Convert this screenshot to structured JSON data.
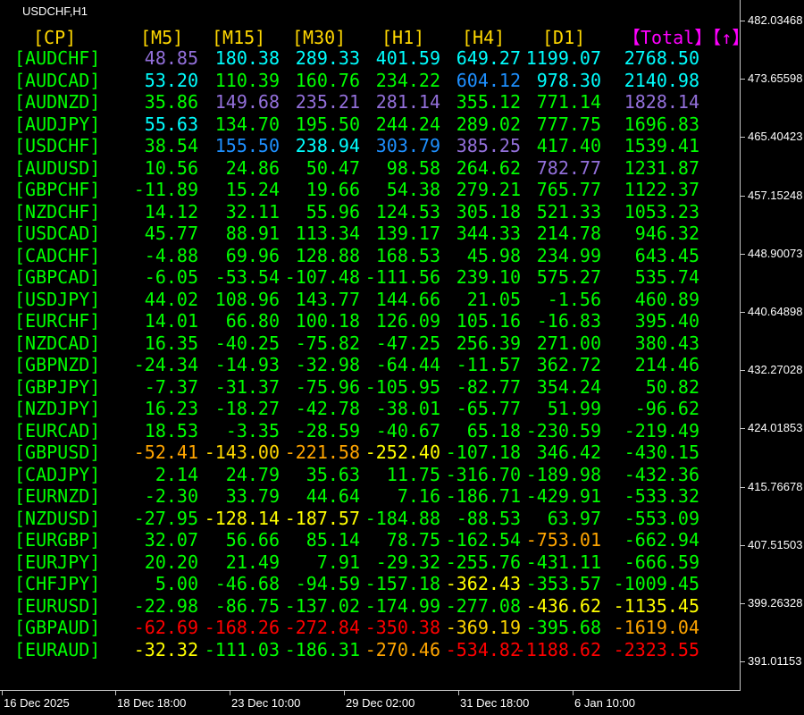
{
  "symbol_label": "USDCHF,H1",
  "headers": [
    "[CP]",
    "[M5]",
    "[M15]",
    "[M30]",
    "[H1]",
    "[H4]",
    "[D1]",
    "【Total】【↑】"
  ],
  "colors": {
    "green": "#00ff00",
    "yellow": "#ffff00",
    "header_yellow": "#ffd700",
    "magenta": "#ff00ff",
    "purple": "#9370db",
    "cyan": "#00ffff",
    "skyblue": "#1e90ff",
    "orange": "#ffa500",
    "gold": "#ffd700",
    "red": "#ff0000"
  },
  "rows": [
    {
      "pair": "[AUDCHF]",
      "values": [
        "48.85",
        "180.38",
        "289.33",
        "401.59",
        "649.27",
        "1199.07",
        "2768.50"
      ],
      "colors": [
        "purple",
        "cyan",
        "cyan",
        "cyan",
        "cyan",
        "cyan",
        "cyan"
      ]
    },
    {
      "pair": "[AUDCAD]",
      "values": [
        "53.20",
        "110.39",
        "160.76",
        "234.22",
        "604.12",
        "978.30",
        "2140.98"
      ],
      "colors": [
        "cyan",
        "green",
        "green",
        "green",
        "skyblue",
        "cyan",
        "cyan"
      ]
    },
    {
      "pair": "[AUDNZD]",
      "values": [
        "35.86",
        "149.68",
        "235.21",
        "281.14",
        "355.12",
        "771.14",
        "1828.14"
      ],
      "colors": [
        "green",
        "purple",
        "purple",
        "purple",
        "green",
        "green",
        "purple"
      ]
    },
    {
      "pair": "[AUDJPY]",
      "values": [
        "55.63",
        "134.70",
        "195.50",
        "244.24",
        "289.02",
        "777.75",
        "1696.83"
      ],
      "colors": [
        "cyan",
        "green",
        "green",
        "green",
        "green",
        "green",
        "green"
      ]
    },
    {
      "pair": "[USDCHF]",
      "values": [
        "38.54",
        "155.50",
        "238.94",
        "303.79",
        "385.25",
        "417.40",
        "1539.41"
      ],
      "colors": [
        "green",
        "skyblue",
        "cyan",
        "skyblue",
        "purple",
        "green",
        "green"
      ]
    },
    {
      "pair": "[AUDUSD]",
      "values": [
        "10.56",
        "24.86",
        "50.47",
        "98.58",
        "264.62",
        "782.77",
        "1231.87"
      ],
      "colors": [
        "green",
        "green",
        "green",
        "green",
        "green",
        "purple",
        "green"
      ]
    },
    {
      "pair": "[GBPCHF]",
      "values": [
        "-11.89",
        "15.24",
        "19.66",
        "54.38",
        "279.21",
        "765.77",
        "1122.37"
      ],
      "colors": [
        "green",
        "green",
        "green",
        "green",
        "green",
        "green",
        "green"
      ]
    },
    {
      "pair": "[NZDCHF]",
      "values": [
        "14.12",
        "32.11",
        "55.96",
        "124.53",
        "305.18",
        "521.33",
        "1053.23"
      ],
      "colors": [
        "green",
        "green",
        "green",
        "green",
        "green",
        "green",
        "green"
      ]
    },
    {
      "pair": "[USDCAD]",
      "values": [
        "45.77",
        "88.91",
        "113.34",
        "139.17",
        "344.33",
        "214.78",
        "946.32"
      ],
      "colors": [
        "green",
        "green",
        "green",
        "green",
        "green",
        "green",
        "green"
      ]
    },
    {
      "pair": "[CADCHF]",
      "values": [
        "-4.88",
        "69.96",
        "128.88",
        "168.53",
        "45.98",
        "234.99",
        "643.45"
      ],
      "colors": [
        "green",
        "green",
        "green",
        "green",
        "green",
        "green",
        "green"
      ]
    },
    {
      "pair": "[GBPCAD]",
      "values": [
        "-6.05",
        "-53.54",
        "-107.48",
        "-111.56",
        "239.10",
        "575.27",
        "535.74"
      ],
      "colors": [
        "green",
        "green",
        "green",
        "green",
        "green",
        "green",
        "green"
      ]
    },
    {
      "pair": "[USDJPY]",
      "values": [
        "44.02",
        "108.96",
        "143.77",
        "144.66",
        "21.05",
        "-1.56",
        "460.89"
      ],
      "colors": [
        "green",
        "green",
        "green",
        "green",
        "green",
        "green",
        "green"
      ]
    },
    {
      "pair": "[EURCHF]",
      "values": [
        "14.01",
        "66.80",
        "100.18",
        "126.09",
        "105.16",
        "-16.83",
        "395.40"
      ],
      "colors": [
        "green",
        "green",
        "green",
        "green",
        "green",
        "green",
        "green"
      ]
    },
    {
      "pair": "[NZDCAD]",
      "values": [
        "16.35",
        "-40.25",
        "-75.82",
        "-47.25",
        "256.39",
        "271.00",
        "380.43"
      ],
      "colors": [
        "green",
        "green",
        "green",
        "green",
        "green",
        "green",
        "green"
      ]
    },
    {
      "pair": "[GBPNZD]",
      "values": [
        "-24.34",
        "-14.93",
        "-32.98",
        "-64.44",
        "-11.57",
        "362.72",
        "214.46"
      ],
      "colors": [
        "green",
        "green",
        "green",
        "green",
        "green",
        "green",
        "green"
      ]
    },
    {
      "pair": "[GBPJPY]",
      "values": [
        "-7.37",
        "-31.37",
        "-75.96",
        "-105.95",
        "-82.77",
        "354.24",
        "50.82"
      ],
      "colors": [
        "green",
        "green",
        "green",
        "green",
        "green",
        "green",
        "green"
      ]
    },
    {
      "pair": "[NZDJPY]",
      "values": [
        "16.23",
        "-18.27",
        "-42.78",
        "-38.01",
        "-65.77",
        "51.99",
        "-96.62"
      ],
      "colors": [
        "green",
        "green",
        "green",
        "green",
        "green",
        "green",
        "green"
      ]
    },
    {
      "pair": "[EURCAD]",
      "values": [
        "18.53",
        "-3.35",
        "-28.59",
        "-40.67",
        "65.18",
        "-230.59",
        "-219.49"
      ],
      "colors": [
        "green",
        "green",
        "green",
        "green",
        "green",
        "green",
        "green"
      ]
    },
    {
      "pair": "[GBPUSD]",
      "values": [
        "-52.41",
        "-143.00",
        "-221.58",
        "-252.40",
        "-107.18",
        "346.42",
        "-430.15"
      ],
      "colors": [
        "orange",
        "gold",
        "orange",
        "yellow",
        "green",
        "green",
        "green"
      ]
    },
    {
      "pair": "[CADJPY]",
      "values": [
        "2.14",
        "24.79",
        "35.63",
        "11.75",
        "-316.70",
        "-189.98",
        "-432.36"
      ],
      "colors": [
        "green",
        "green",
        "green",
        "green",
        "green",
        "green",
        "green"
      ]
    },
    {
      "pair": "[EURNZD]",
      "values": [
        "-2.30",
        "33.79",
        "44.64",
        "7.16",
        "-186.71",
        "-429.91",
        "-533.32"
      ],
      "colors": [
        "green",
        "green",
        "green",
        "green",
        "green",
        "green",
        "green"
      ]
    },
    {
      "pair": "[NZDUSD]",
      "values": [
        "-27.95",
        "-128.14",
        "-187.57",
        "-184.88",
        "-88.53",
        "63.97",
        "-553.09"
      ],
      "colors": [
        "green",
        "yellow",
        "yellow",
        "green",
        "green",
        "green",
        "green"
      ]
    },
    {
      "pair": "[EURGBP]",
      "values": [
        "32.07",
        "56.66",
        "85.14",
        "78.75",
        "-162.54",
        "-753.01",
        "-662.94"
      ],
      "colors": [
        "green",
        "green",
        "green",
        "green",
        "green",
        "orange",
        "green"
      ]
    },
    {
      "pair": "[EURJPY]",
      "values": [
        "20.20",
        "21.49",
        "7.91",
        "-29.32",
        "-255.76",
        "-431.11",
        "-666.59"
      ],
      "colors": [
        "green",
        "green",
        "green",
        "green",
        "green",
        "green",
        "green"
      ]
    },
    {
      "pair": "[CHFJPY]",
      "values": [
        "5.00",
        "-46.68",
        "-94.59",
        "-157.18",
        "-362.43",
        "-353.57",
        "-1009.45"
      ],
      "colors": [
        "green",
        "green",
        "green",
        "green",
        "yellow",
        "green",
        "green"
      ]
    },
    {
      "pair": "[EURUSD]",
      "values": [
        "-22.98",
        "-86.75",
        "-137.02",
        "-174.99",
        "-277.08",
        "-436.62",
        "-1135.45"
      ],
      "colors": [
        "green",
        "green",
        "green",
        "green",
        "green",
        "yellow",
        "yellow"
      ]
    },
    {
      "pair": "[GBPAUD]",
      "values": [
        "-62.69",
        "-168.26",
        "-272.84",
        "-350.38",
        "-369.19",
        "-395.68",
        "-1619.04"
      ],
      "colors": [
        "red",
        "red",
        "red",
        "red",
        "gold",
        "green",
        "orange"
      ]
    },
    {
      "pair": "[EURAUD]",
      "values": [
        "-32.32",
        "-111.03",
        "-186.31",
        "-270.46",
        "-534.82",
        "-1188.62",
        "-2323.55"
      ],
      "colors": [
        "yellow",
        "green",
        "green",
        "orange",
        "red",
        "red",
        "red"
      ]
    }
  ],
  "y_axis": [
    "482.03468",
    "473.65598",
    "465.40423",
    "457.15248",
    "448.90073",
    "440.64898",
    "432.27028",
    "424.01853",
    "415.76678",
    "407.51503",
    "399.26328",
    "391.01153"
  ],
  "x_axis": [
    "16 Dec 2025",
    "18 Dec 18:00",
    "23 Dec 10:00",
    "29 Dec 02:00",
    "31 Dec 18:00",
    "6 Jan 10:00"
  ]
}
